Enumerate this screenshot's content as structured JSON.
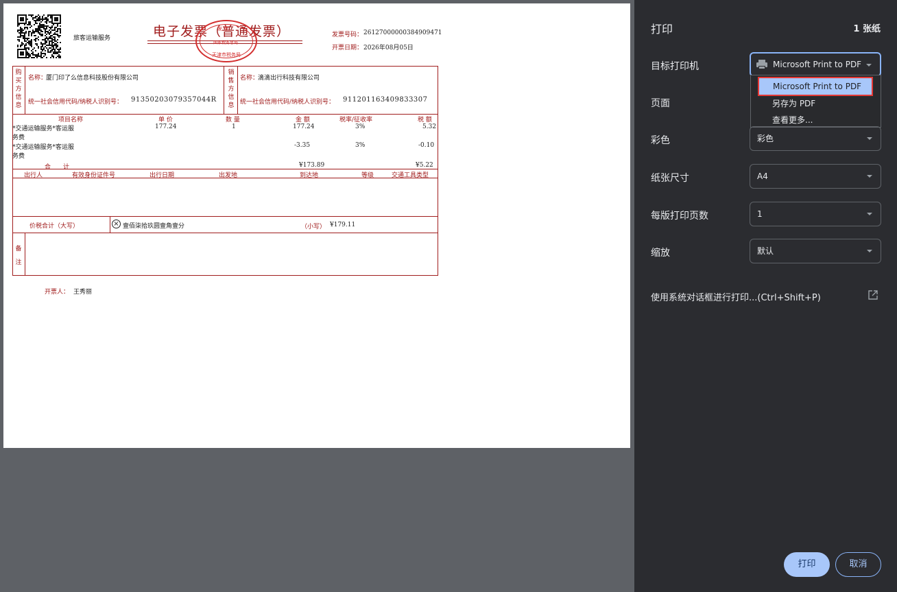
{
  "invoice": {
    "service_type": "旅客运输服务",
    "title": "电子发票（普通发票）",
    "number_label": "发票号码：",
    "number": "26127000000384909471",
    "date_label": "开票日期：",
    "date": "2026年08月05日",
    "stamp_line1": "发 票",
    "stamp_line2": "国家税务总局",
    "stamp_line3": "天津市税务局",
    "buyer_vlabel": "购买方信息",
    "buyer_name_label": "名称：",
    "buyer_name": "厦门印了么信息科技股份有限公司",
    "buyer_tax_label": "统一社会信用代码/纳税人识别号：",
    "buyer_tax": "91350203079357044R",
    "seller_vlabel": "销售方信息",
    "seller_name_label": "名称：",
    "seller_name": "滴滴出行科技有限公司",
    "seller_tax_label": "统一社会信用代码/纳税人识别号：",
    "seller_tax": "911201163409833307",
    "col_item": "项目名称",
    "col_price": "单 价",
    "col_qty": "数 量",
    "col_amount": "金 额",
    "col_rate": "税率/征收率",
    "col_tax": "税 额",
    "rows": [
      {
        "item1": "*交通运输服务*客运服",
        "item2": "务费",
        "price": "177.24",
        "qty": "1",
        "amount": "177.24",
        "rate": "3%",
        "tax": "5.32"
      },
      {
        "item1": "*交通运输服务*客运服",
        "item2": "务费",
        "price": "",
        "qty": "",
        "amount": "-3.35",
        "rate": "3%",
        "tax": "-0.10"
      }
    ],
    "total_label": "合　　计",
    "total_amount": "¥173.89",
    "total_tax": "¥5.22",
    "trav_cols": [
      "出行人",
      "有效身份证件号",
      "出行日期",
      "出发地",
      "到达地",
      "等级",
      "交通工具类型"
    ],
    "sum_label": "价税合计（大写）",
    "sum_upper": "壹佰柒拾玖圆壹角壹分",
    "sum_lower_label": "（小写）",
    "sum_lower": "¥179.11",
    "remark_vlabel": "备注",
    "issuer_label": "开票人：",
    "issuer": "王秀丽"
  },
  "panel": {
    "title": "打印",
    "sheets": "1 张纸",
    "printer_label": "目标打印机",
    "printer_value": "Microsoft Print to PDF",
    "dropdown": [
      "Microsoft Print to PDF",
      "另存为 PDF",
      "查看更多..."
    ],
    "pages_label": "页面",
    "color_label": "彩色",
    "color_value": "彩色",
    "paper_label": "纸张尺寸",
    "paper_value": "A4",
    "pps_label": "每版打印页数",
    "pps_value": "1",
    "scale_label": "缩放",
    "scale_value": "默认",
    "system_dialog": "使用系统对话框进行打印...(Ctrl+Shift+P)",
    "print_button": "打印",
    "cancel_button": "取消"
  },
  "colors": {
    "accent": "#8ab4f8",
    "invoice_red": "#a01c1c",
    "highlight_border": "#e53935"
  }
}
